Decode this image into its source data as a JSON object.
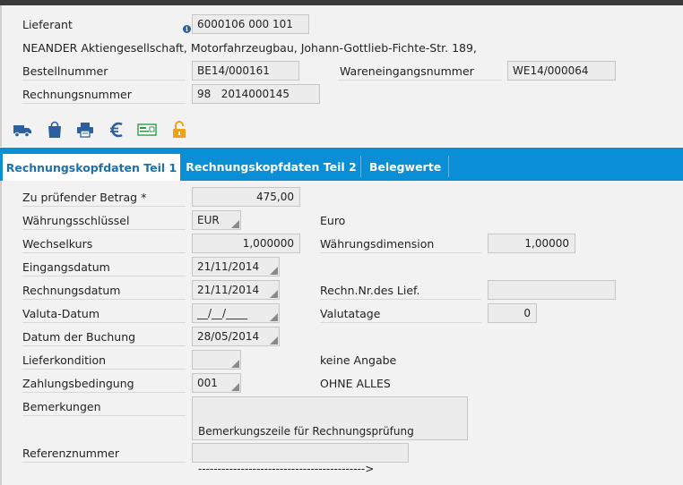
{
  "header": {
    "lieferant_label": "Lieferant",
    "lieferant_value": "6000106 000 101",
    "vendor_address": "NEANDER Aktiengesellschaft, Motorfahrzeugbau, Johann-Gottlieb-Fichte-Str. 189,",
    "bestellnummer_label": "Bestellnummer",
    "bestellnummer_value": "BE14/000161",
    "wareneingang_label": "Wareneingangsnummer",
    "wareneingang_value": "WE14/000064",
    "rechnungsnummer_label": "Rechnungsnummer",
    "rechnungsnummer_value": "98   2014000145"
  },
  "toolbar": {
    "icons": [
      "truck-icon",
      "shopping-bag-icon",
      "printer-icon",
      "euro-icon",
      "payment-card-icon",
      "unlock-icon"
    ]
  },
  "tabs": [
    {
      "label": "Rechnungskopfdaten Teil 1",
      "active": true
    },
    {
      "label": "Rechnungskopfdaten Teil 2",
      "active": false
    },
    {
      "label": "Belegwerte",
      "active": false
    }
  ],
  "form": {
    "betrag_label": "Zu prüfender Betrag *",
    "betrag_value": "475,00",
    "waehrung_label": "Währungsschlüssel",
    "waehrung_value": "EUR",
    "waehrung_text": "Euro",
    "wechselkurs_label": "Wechselkurs",
    "wechselkurs_value": "1,000000",
    "dimension_label": "Währungsdimension",
    "dimension_value": "1,00000",
    "eingangsdatum_label": "Eingangsdatum",
    "eingangsdatum_value": "21/11/2014",
    "rechnungsdatum_label": "Rechnungsdatum",
    "rechnungsdatum_value": "21/11/2014",
    "rechnr_lief_label": "Rechn.Nr.des Lief.",
    "rechnr_lief_value": "",
    "valuta_label": "Valuta-Datum",
    "valuta_value": "__/__/____",
    "valutatage_label": "Valutatage",
    "valutatage_value": "0",
    "buchung_label": "Datum der Buchung",
    "buchung_value": "28/05/2014",
    "lieferkondition_label": "Lieferkondition",
    "lieferkondition_value": "",
    "lieferkondition_text": "keine Angabe",
    "zahlungsbedingung_label": "Zahlungsbedingung",
    "zahlungsbedingung_value": "001",
    "zahlungsbedingung_text": "OHNE ALLES",
    "bemerkungen_label": "Bemerkungen",
    "bemerkungen_line1": "Bemerkungszeile für Rechnungsprüfung",
    "bemerkungen_line2": "------------------------------------------->",
    "referenz_label": "Referenznummer",
    "referenz_value": ""
  },
  "colors": {
    "tab_bar": "#0a8fd6",
    "active_tab_text": "#1d6fae",
    "icon_blue": "#2c5f9e",
    "icon_orange": "#f0a11c",
    "icon_green": "#2f9a4a"
  }
}
